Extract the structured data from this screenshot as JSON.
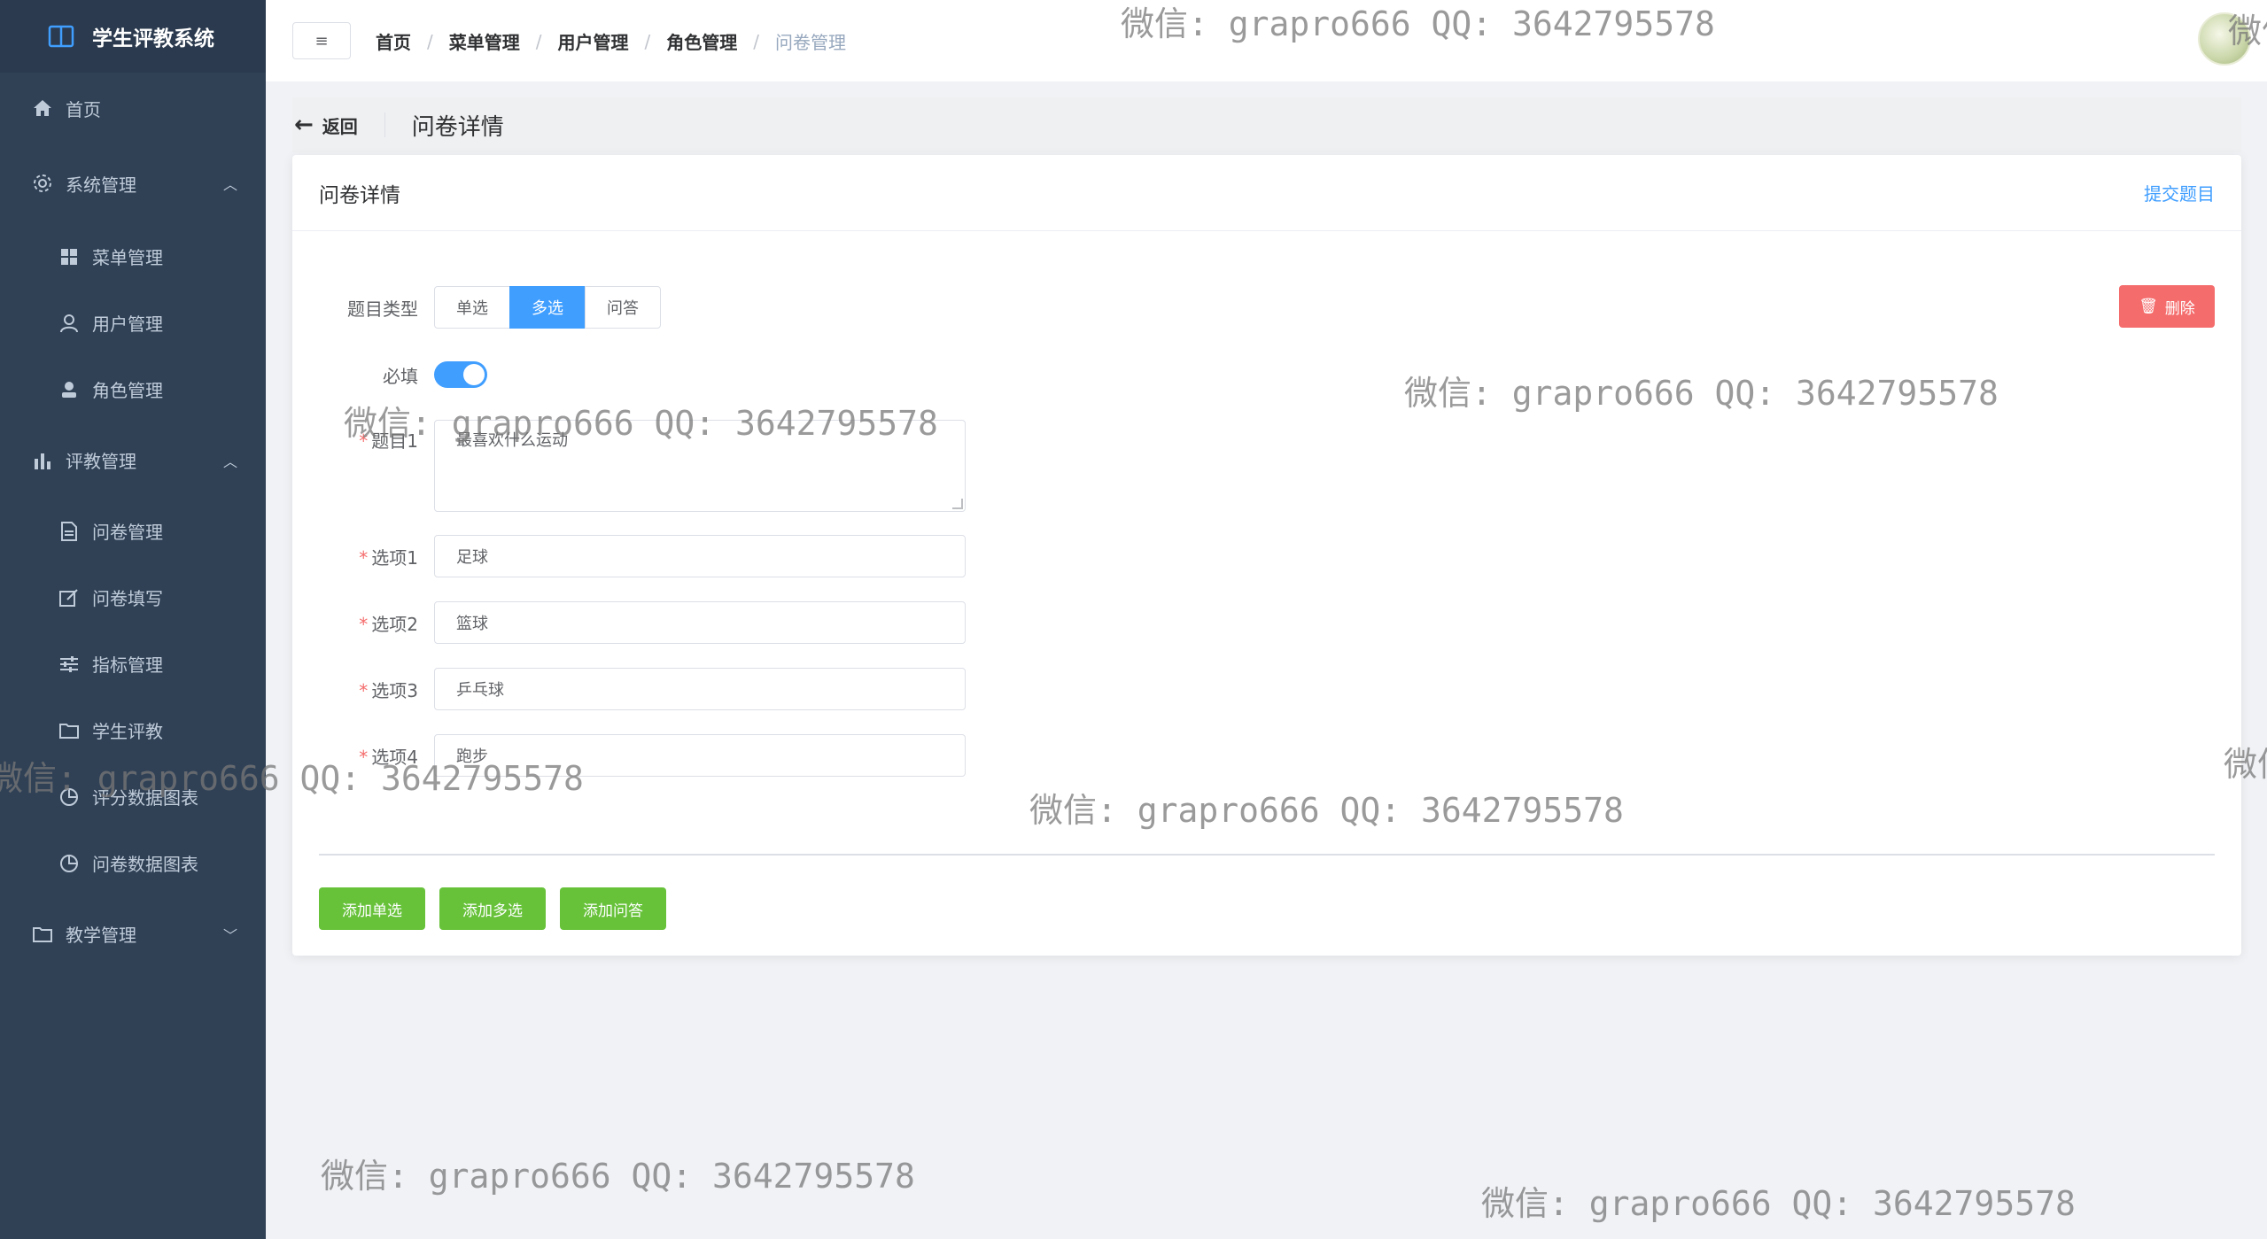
{
  "app": {
    "title": "学生评教系统"
  },
  "sidebar": {
    "items": [
      {
        "label": "首页",
        "icon": "home-icon"
      },
      {
        "label": "系统管理",
        "icon": "gear-icon",
        "expanded": true
      },
      {
        "label": "菜单管理",
        "icon": "grid-icon"
      },
      {
        "label": "用户管理",
        "icon": "user-icon"
      },
      {
        "label": "角色管理",
        "icon": "role-icon"
      },
      {
        "label": "评教管理",
        "icon": "bar-chart-icon",
        "expanded": true
      },
      {
        "label": "问卷管理",
        "icon": "document-icon"
      },
      {
        "label": "问卷填写",
        "icon": "edit-icon"
      },
      {
        "label": "指标管理",
        "icon": "sliders-icon"
      },
      {
        "label": "学生评教",
        "icon": "folder-icon"
      },
      {
        "label": "评分数据图表",
        "icon": "pie-chart-icon"
      },
      {
        "label": "问卷数据图表",
        "icon": "pie-chart-icon"
      },
      {
        "label": "教学管理",
        "icon": "folder-icon",
        "expanded": false
      }
    ]
  },
  "header": {
    "menu_icon": "≡",
    "breadcrumb": [
      "首页",
      "菜单管理",
      "用户管理",
      "角色管理",
      "问卷管理"
    ],
    "separator": "/"
  },
  "page_header": {
    "back_label": "返回",
    "title": "问卷详情"
  },
  "card": {
    "title": "问卷详情",
    "submit_label": "提交题目",
    "delete_label": "删除",
    "question_type": {
      "label": "题目类型",
      "options": [
        "单选",
        "多选",
        "问答"
      ],
      "selected": "多选"
    },
    "required": {
      "label": "必填",
      "on": true
    },
    "question": {
      "label": "题目1",
      "value": "最喜欢什么运动"
    },
    "options": [
      {
        "label": "选项1",
        "value": "足球"
      },
      {
        "label": "选项2",
        "value": "篮球"
      },
      {
        "label": "选项3",
        "value": "乒乓球"
      },
      {
        "label": "选项4",
        "value": "跑步"
      }
    ],
    "add_buttons": [
      "添加单选",
      "添加多选",
      "添加问答"
    ]
  },
  "watermarks": [
    "微信: grapro666 QQ: 3642795578",
    "微信: grapro666 QQ: 3642795578",
    "微信: grapro666 QQ: 3642795578",
    "微信: grapro666 QQ: 3642795578",
    "微信: grapro666 QQ: 3642795578",
    "微信: grapro666 QQ: 3642795578",
    "微信: grapro666 QQ: 3642795578",
    "微信",
    "微信"
  ],
  "colors": {
    "sidebar_bg": "#304156",
    "primary": "#409eff",
    "danger": "#f56c6c",
    "success": "#67c23a"
  }
}
